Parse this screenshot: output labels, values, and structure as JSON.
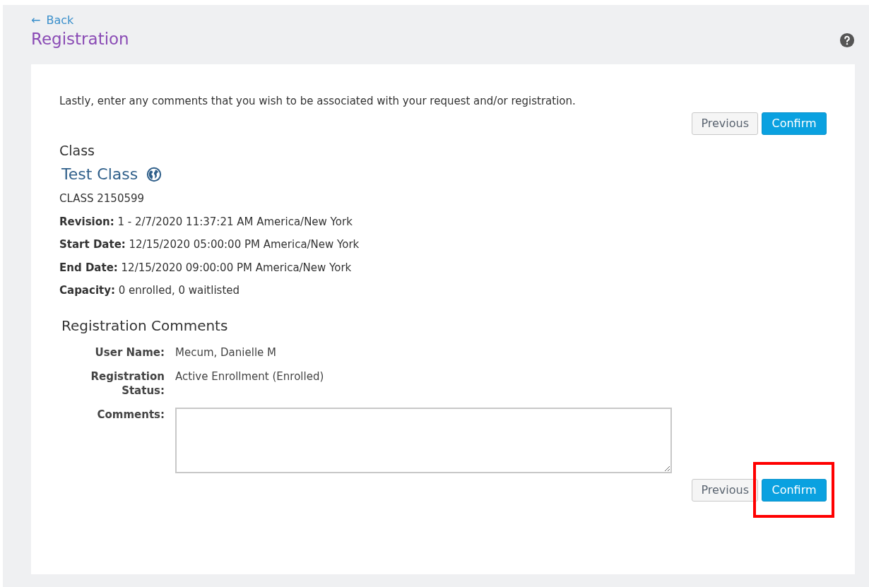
{
  "back_link": {
    "arrow": "←",
    "label": "Back"
  },
  "page_title": "Registration",
  "intro": "Lastly, enter any comments that you wish to be associated with your request and/or registration.",
  "top_actions": [
    {
      "label": "Previous",
      "kind": "secondary",
      "highlighted": false
    },
    {
      "label": "Confirm",
      "kind": "primary",
      "highlighted": false
    }
  ],
  "class_section": {
    "heading": "Class",
    "name": "Test Class",
    "code": "CLASS 2150599",
    "details": [
      "**Revision:** 1 - 2/7/2020 11:37:21 AM America/New York",
      "**Start Date:** 12/15/2020 05:00:00 PM America/New York",
      "**End Date:** 12/15/2020 09:00:00 PM America/New York",
      "**Capacity:** 0 enrolled, 0 waitlisted"
    ]
  },
  "comments_section": {
    "heading": "Registration Comments",
    "fields": [
      {
        "label": "User Name:",
        "kind": "text",
        "value": "Mecum, Danielle M"
      },
      {
        "label": "Registration Status:",
        "kind": "text",
        "value": "Active Enrollment (Enrolled)"
      },
      {
        "label": "Comments:",
        "kind": "textarea"
      }
    ]
  },
  "bottom_actions": [
    {
      "label": "Previous",
      "kind": "secondary",
      "highlighted": false
    },
    {
      "label": "Confirm",
      "kind": "primary",
      "highlighted": true
    }
  ]
}
